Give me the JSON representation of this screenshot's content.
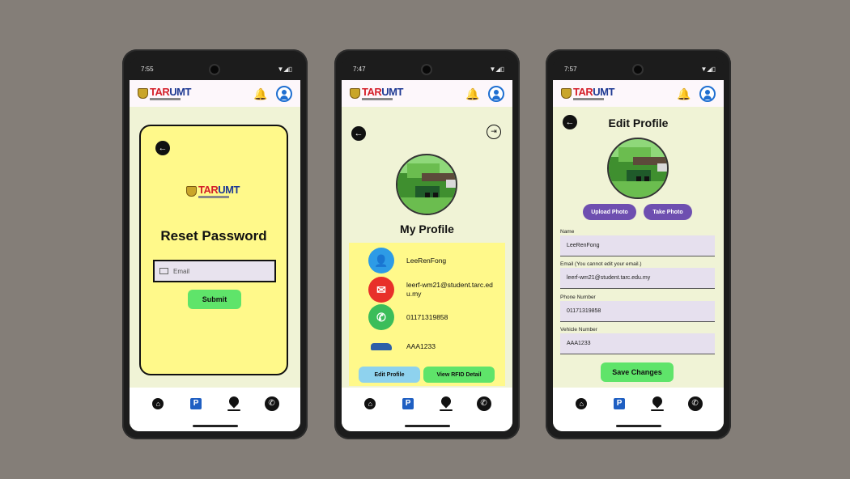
{
  "phones": [
    {
      "status_time": "7:55",
      "screen_title": "Reset Password",
      "email_placeholder": "Email",
      "submit_label": "Submit"
    },
    {
      "status_time": "7:47",
      "screen_title": "My Profile",
      "name": "LeeRenFong",
      "email": "leerf-wm21@student.tarc.edu.my",
      "phone": "01171319858",
      "vehicle": "AAA1233",
      "edit_profile_label": "Edit Profile",
      "view_rfid_label": "View RFID Detail"
    },
    {
      "status_time": "7:57",
      "screen_title": "Edit Profile",
      "upload_photo_label": "Upload Photo",
      "take_photo_label": "Take Photo",
      "name_label": "Name",
      "name_value": "LeeRenFong",
      "email_label": "Email (You cannot edit your email.)",
      "email_value": "leerf-wm21@student.tarc.edu.my",
      "phone_label": "Phone Number",
      "phone_value": "01171319858",
      "vehicle_label": "Vehicle Number",
      "vehicle_value": "AAA1233",
      "save_label": "Save Changes"
    }
  ],
  "brand": {
    "tar": "TAR",
    "umt": "UMT"
  },
  "nav_icons": [
    "home-icon",
    "parking-icon",
    "location-pin-icon",
    "phone-call-icon"
  ],
  "colors": {
    "background": "#847e78",
    "app_bg": "#f0f3d6",
    "card_yellow": "#fff98a",
    "green_button": "#5fe46a",
    "purple_button": "#6e4fb0",
    "blue_button": "#8ed2ee",
    "brand_red": "#d4202a",
    "brand_blue": "#1f3a93"
  }
}
